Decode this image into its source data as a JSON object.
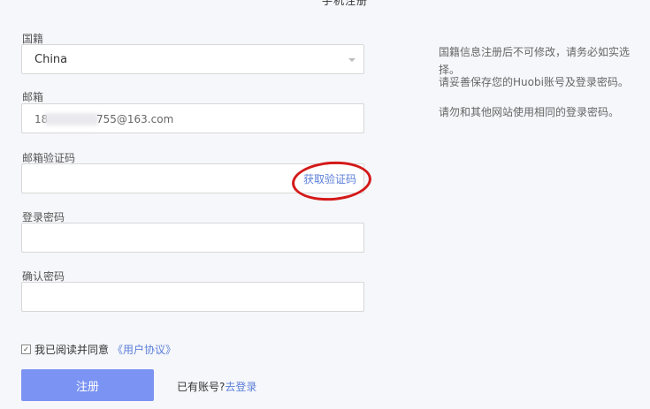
{
  "header": {
    "tab_label": "手机注册"
  },
  "form": {
    "nationality": {
      "label": "国籍",
      "value": "China"
    },
    "email": {
      "label": "邮箱",
      "value_prefix": "18",
      "value_suffix": "755@163.com"
    },
    "email_code": {
      "label": "邮箱验证码",
      "value": "",
      "get_code_label": "获取验证码"
    },
    "password": {
      "label": "登录密码",
      "value": ""
    },
    "confirm_password": {
      "label": "确认密码",
      "value": ""
    }
  },
  "notes": [
    "国籍信息注册后不可修改，请务必如实选择。",
    "请妥善保存您的Huobi账号及登录密码。",
    "请勿和其他网站使用相同的登录密码。"
  ],
  "agreement": {
    "checked": true,
    "prefix": "我已阅读并同意",
    "link": "《用户协议》"
  },
  "actions": {
    "register_label": "注册",
    "have_account": "已有账号?",
    "login_link": "去登录"
  }
}
